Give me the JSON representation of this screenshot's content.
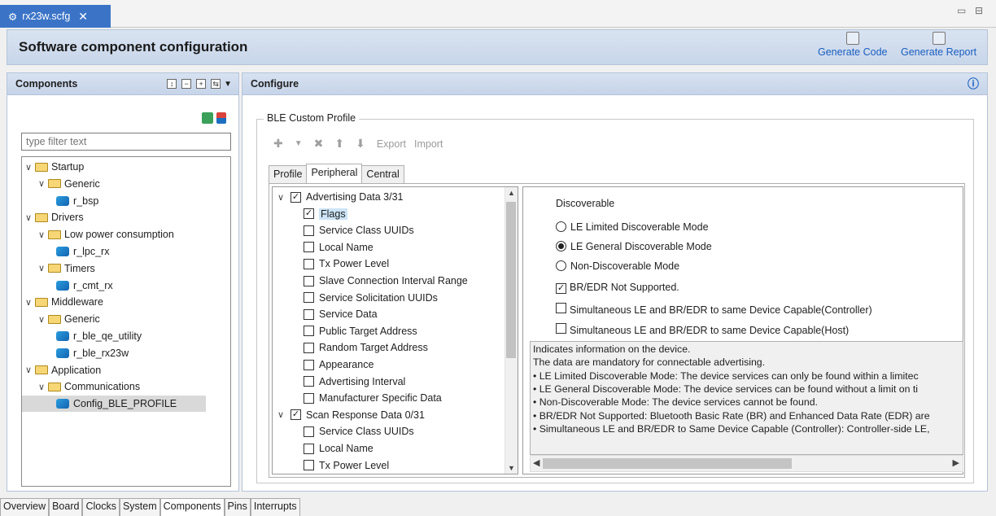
{
  "editor_tab": {
    "label": "rx23w.scfg",
    "close": "✕"
  },
  "window": {
    "minimize": "▭",
    "maximize": "⊟"
  },
  "header": {
    "title": "Software component configuration",
    "generate_code": "Generate Code",
    "generate_report": "Generate Report"
  },
  "components": {
    "title": "Components",
    "filter_placeholder": "type filter text",
    "tree": [
      {
        "label": "Startup",
        "level": 0,
        "type": "folder"
      },
      {
        "label": "Generic",
        "level": 1,
        "type": "folder"
      },
      {
        "label": "r_bsp",
        "level": 2,
        "type": "component"
      },
      {
        "label": "Drivers",
        "level": 0,
        "type": "folder"
      },
      {
        "label": "Low power consumption",
        "level": 1,
        "type": "folder"
      },
      {
        "label": "r_lpc_rx",
        "level": 2,
        "type": "component"
      },
      {
        "label": "Timers",
        "level": 1,
        "type": "folder"
      },
      {
        "label": "r_cmt_rx",
        "level": 2,
        "type": "component"
      },
      {
        "label": "Middleware",
        "level": 0,
        "type": "folder"
      },
      {
        "label": "Generic",
        "level": 1,
        "type": "folder"
      },
      {
        "label": "r_ble_qe_utility",
        "level": 2,
        "type": "component"
      },
      {
        "label": "r_ble_rx23w",
        "level": 2,
        "type": "component"
      },
      {
        "label": "Application",
        "level": 0,
        "type": "folder"
      },
      {
        "label": "Communications",
        "level": 1,
        "type": "folder"
      },
      {
        "label": "Config_BLE_PROFILE",
        "level": 2,
        "type": "component",
        "selected": true
      }
    ]
  },
  "configure": {
    "title": "Configure",
    "info_icon": "ⓘ",
    "group_title": "BLE Custom Profile",
    "toolbar": {
      "export": "Export",
      "import": "Import"
    },
    "tabs": [
      "Profile",
      "Peripheral",
      "Central"
    ],
    "active_tab": "Peripheral",
    "list": [
      {
        "label": "Advertising Data 3/31",
        "level": 0,
        "checked": true,
        "expandable": true
      },
      {
        "label": "Flags",
        "level": 1,
        "checked": true,
        "selected": true
      },
      {
        "label": "Service Class UUIDs",
        "level": 1,
        "checked": false
      },
      {
        "label": "Local Name",
        "level": 1,
        "checked": false
      },
      {
        "label": "Tx Power Level",
        "level": 1,
        "checked": false
      },
      {
        "label": "Slave Connection Interval Range",
        "level": 1,
        "checked": false
      },
      {
        "label": "Service Solicitation UUIDs",
        "level": 1,
        "checked": false
      },
      {
        "label": "Service Data",
        "level": 1,
        "checked": false
      },
      {
        "label": "Public Target Address",
        "level": 1,
        "checked": false
      },
      {
        "label": "Random Target Address",
        "level": 1,
        "checked": false
      },
      {
        "label": "Appearance",
        "level": 1,
        "checked": false
      },
      {
        "label": "Advertising Interval",
        "level": 1,
        "checked": false
      },
      {
        "label": "Manufacturer Specific Data",
        "level": 1,
        "checked": false
      },
      {
        "label": "Scan Response Data 0/31",
        "level": 0,
        "checked": true,
        "expandable": true
      },
      {
        "label": "Service Class UUIDs",
        "level": 1,
        "checked": false
      },
      {
        "label": "Local Name",
        "level": 1,
        "checked": false
      },
      {
        "label": "Tx Power Level",
        "level": 1,
        "checked": false
      }
    ],
    "discoverable": {
      "label": "Discoverable",
      "options": [
        "LE Limited Discoverable Mode",
        "LE General Discoverable Mode",
        "Non-Discoverable Mode"
      ],
      "selected": "LE General Discoverable Mode"
    },
    "checks": [
      {
        "label": "BR/EDR Not Supported.",
        "checked": true
      },
      {
        "label": "Simultaneous LE and BR/EDR to same Device Capable(Controller)",
        "checked": false
      },
      {
        "label": "Simultaneous LE and BR/EDR to same Device Capable(Host)",
        "checked": false
      }
    ],
    "description": [
      "Indicates information on the device.",
      "The data are mandatory for connectable advertising.",
      "• LE Limited Discoverable Mode: The device services can only be found within a limitec",
      "• LE General Discoverable Mode: The device services can be found without a limit on ti",
      "• Non-Discoverable Mode: The device services cannot be found.",
      "• BR/EDR Not Supported: Bluetooth Basic Rate (BR) and Enhanced Data Rate (EDR) are",
      "• Simultaneous LE and BR/EDR to Same Device Capable (Controller): Controller-side LE,"
    ]
  },
  "bottom_tabs": [
    "Overview",
    "Board",
    "Clocks",
    "System",
    "Components",
    "Pins",
    "Interrupts"
  ],
  "active_bottom_tab": "Components"
}
